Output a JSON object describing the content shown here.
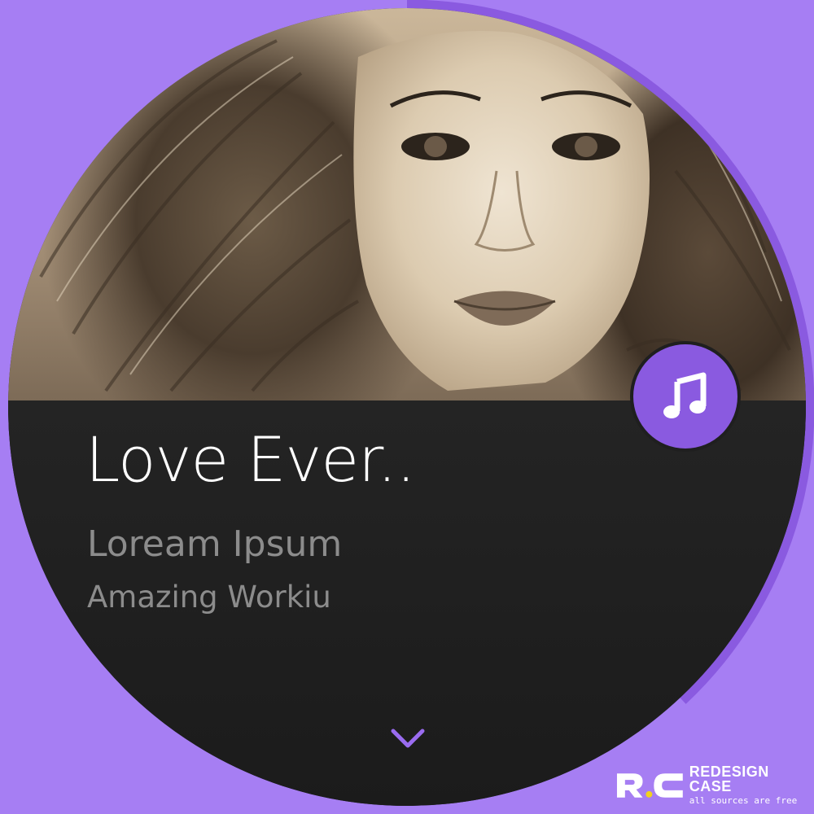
{
  "player": {
    "song_title": "Love Ever..",
    "artist": "Loream Ipsum",
    "album": "Amazing Workiu",
    "progress_fraction": 0.38
  },
  "icons": {
    "music": "music-note-icon",
    "expand": "chevron-down-icon"
  },
  "watermark": {
    "title": "REDESIGN CASE",
    "subtitle": "all sources are free"
  },
  "colors": {
    "background": "#a67ef3",
    "accent": "#8a5ae0",
    "panel": "#1f1f1f",
    "title_text": "#ffffff",
    "secondary_text": "#8c8c8c"
  }
}
